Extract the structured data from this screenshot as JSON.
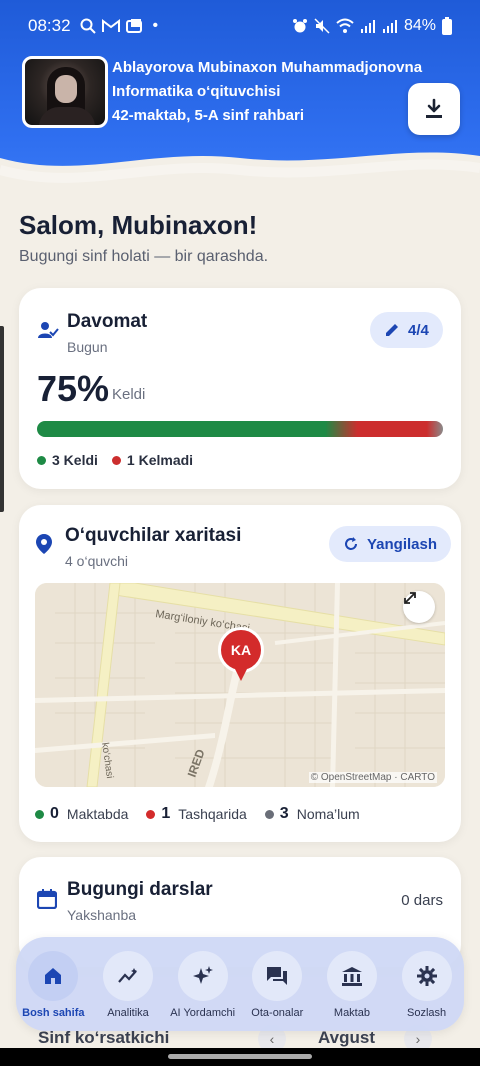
{
  "status_bar": {
    "time": "08:32",
    "battery": "84%"
  },
  "profile": {
    "name": "Ablayorova Mubinaxon Muhammadjonovna",
    "role": "Informatika o‘qituvchisi",
    "school": "42-maktab, 5-A sinf rahbari"
  },
  "greeting": {
    "title": "Salom, Mubinaxon!",
    "subtitle": "Bugungi sinf holati — bir qarashda."
  },
  "attendance": {
    "title": "Davomat",
    "subtitle": "Bugun",
    "edit_label": "4/4",
    "percent": "75%",
    "percent_label": "Keldi",
    "present_fraction": 0.75,
    "present_label": "3 Keldi",
    "absent_label": "1 Kelmadi",
    "colors": {
      "present": "#1e8a45",
      "absent": "#cc2e2e"
    }
  },
  "student_map": {
    "title": "O‘quvchilar xaritasi",
    "subtitle": "4 o‘quvchi",
    "refresh_label": "Yangilash",
    "street_label": "Marg‘iloniy ko‘chasi",
    "street_label_2": "ko‘chasi",
    "pin_initials": "KA",
    "attribution": "© OpenStreetMap · CARTO",
    "legend": [
      {
        "count": "0",
        "label": "Maktabda",
        "color": "#1e8a45"
      },
      {
        "count": "1",
        "label": "Tashqarida",
        "color": "#d32b2b"
      },
      {
        "count": "3",
        "label": "Noma’lum",
        "color": "#6a6e78"
      }
    ]
  },
  "lessons": {
    "title": "Bugungi darslar",
    "subtitle": "Yakshanba",
    "count_label": "0 dars"
  },
  "class_stats": {
    "title": "Sinf ko‘rsatkichi",
    "month": "Avgust"
  },
  "nav": [
    {
      "label": "Bosh sahifa",
      "icon": "home-icon"
    },
    {
      "label": "Analitika",
      "icon": "analytics-icon"
    },
    {
      "label": "AI Yordamchi",
      "icon": "sparkle-icon"
    },
    {
      "label": "Ota-onalar",
      "icon": "chat-icon"
    },
    {
      "label": "Maktab",
      "icon": "school-icon"
    },
    {
      "label": "Sozlash",
      "icon": "gear-icon"
    }
  ]
}
